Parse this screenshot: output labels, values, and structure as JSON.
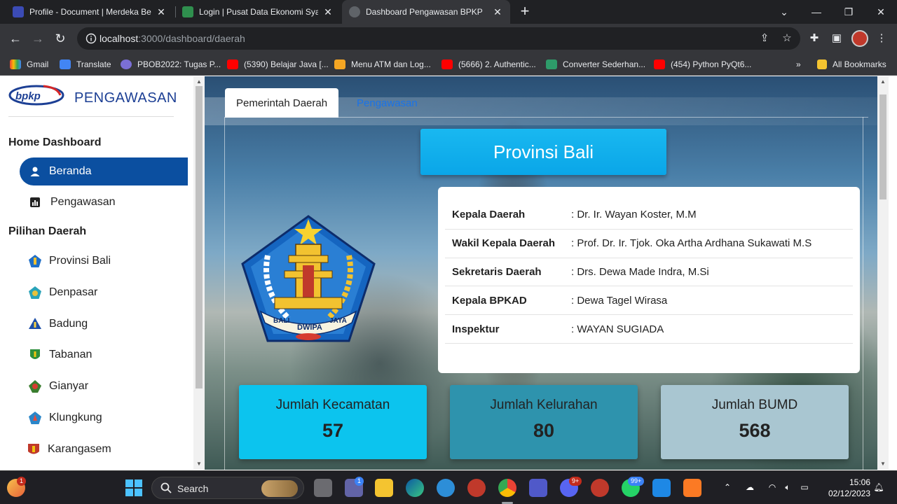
{
  "browser": {
    "tabs": [
      {
        "title": "Profile - Document | Merdeka Be",
        "active": false
      },
      {
        "title": "Login | Pusat Data Ekonomi Syar",
        "active": false
      },
      {
        "title": "Dashboard Pengawasan BPKP",
        "active": true
      }
    ],
    "url_host": "localhost",
    "url_path": ":3000/dashboard/daerah",
    "bookmarks": [
      {
        "label": "Gmail",
        "icon": "gmail-icon"
      },
      {
        "label": "Translate",
        "icon": "translate-icon"
      },
      {
        "label": "PBOB2022: Tugas P...",
        "icon": "pbob-icon"
      },
      {
        "label": "(5390) Belajar Java [...",
        "icon": "youtube-icon"
      },
      {
        "label": "Menu ATM dan Log...",
        "icon": "box-icon"
      },
      {
        "label": "(5666) 2. Authentic...",
        "icon": "youtube-icon"
      },
      {
        "label": "Converter Sederhan...",
        "icon": "page-icon"
      },
      {
        "label": "(454) Python PyQt6...",
        "icon": "youtube-icon"
      }
    ],
    "all_bookmarks": "All Bookmarks"
  },
  "sidebar": {
    "brand": "bpkp",
    "title": "PENGAWASAN",
    "sections": [
      {
        "heading": "Home Dashboard",
        "items": [
          {
            "label": "Beranda",
            "icon": "person-icon",
            "active": true
          },
          {
            "label": "Pengawasan",
            "icon": "bar-chart-icon",
            "active": false
          }
        ]
      },
      {
        "heading": "Pilihan Daerah",
        "items": [
          {
            "label": "Provinsi Bali",
            "icon": "emblem-icon"
          },
          {
            "label": "Denpasar",
            "icon": "emblem-icon"
          },
          {
            "label": "Badung",
            "icon": "emblem-icon"
          },
          {
            "label": "Tabanan",
            "icon": "emblem-icon"
          },
          {
            "label": "Gianyar",
            "icon": "emblem-icon"
          },
          {
            "label": "Klungkung",
            "icon": "emblem-icon"
          },
          {
            "label": "Karangasem",
            "icon": "emblem-icon"
          }
        ]
      }
    ]
  },
  "main": {
    "tabs": [
      {
        "label": "Pemerintah Daerah",
        "active": true
      },
      {
        "label": "Pengawasan",
        "active": false
      }
    ],
    "region": "Provinsi Bali",
    "emblem_text": [
      "BALI",
      "DWIPA",
      "JAYA"
    ],
    "officials": [
      {
        "label": "Kepala Daerah",
        "value": ": Dr. Ir. Wayan Koster, M.M"
      },
      {
        "label": "Wakil Kepala Daerah",
        "value": ": Prof. Dr. Ir. Tjok. Oka Artha Ardhana Sukawati M.S"
      },
      {
        "label": "Sekretaris Daerah",
        "value": ": Drs. Dewa Made Indra, M.Si"
      },
      {
        "label": "Kepala BPKAD",
        "value": ": Dewa Tagel Wirasa"
      },
      {
        "label": "Inspektur",
        "value": ": WAYAN SUGIADA"
      }
    ],
    "stats": [
      {
        "label": "Jumlah Kecamatan",
        "value": "57",
        "color": "#0cc4ee"
      },
      {
        "label": "Jumlah Kelurahan",
        "value": "80",
        "color": "#2e93ad"
      },
      {
        "label": "Jumlah BUMD",
        "value": "568",
        "color": "#a9c6d1"
      }
    ]
  },
  "taskbar": {
    "search": "Search",
    "badges": {
      "widgets": "1",
      "chat": "1",
      "discord": "9+",
      "whatsapp": "99+"
    },
    "time": "15:06",
    "date": "02/12/2023"
  },
  "colors": {
    "brand_blue": "#0b4fa0",
    "banner_blue": "#19b8f0",
    "link_blue": "#1a73e8"
  }
}
